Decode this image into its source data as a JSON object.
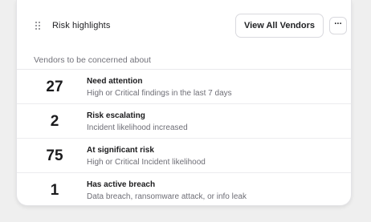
{
  "widget": {
    "title": "Risk highlights",
    "view_all_label": "View All Vendors",
    "more_label": "···",
    "subheading": "Vendors to be concerned about"
  },
  "highlights": [
    {
      "count": "27",
      "label": "Need attention",
      "description": "High or Critical findings in the last 7 days"
    },
    {
      "count": "2",
      "label": "Risk escalating",
      "description": "Incident likelihood increased"
    },
    {
      "count": "75",
      "label": "At significant risk",
      "description": "High or Critical Incident likelihood"
    },
    {
      "count": "1",
      "label": "Has active breach",
      "description": "Data breach, ransomware attack, or info leak"
    }
  ]
}
